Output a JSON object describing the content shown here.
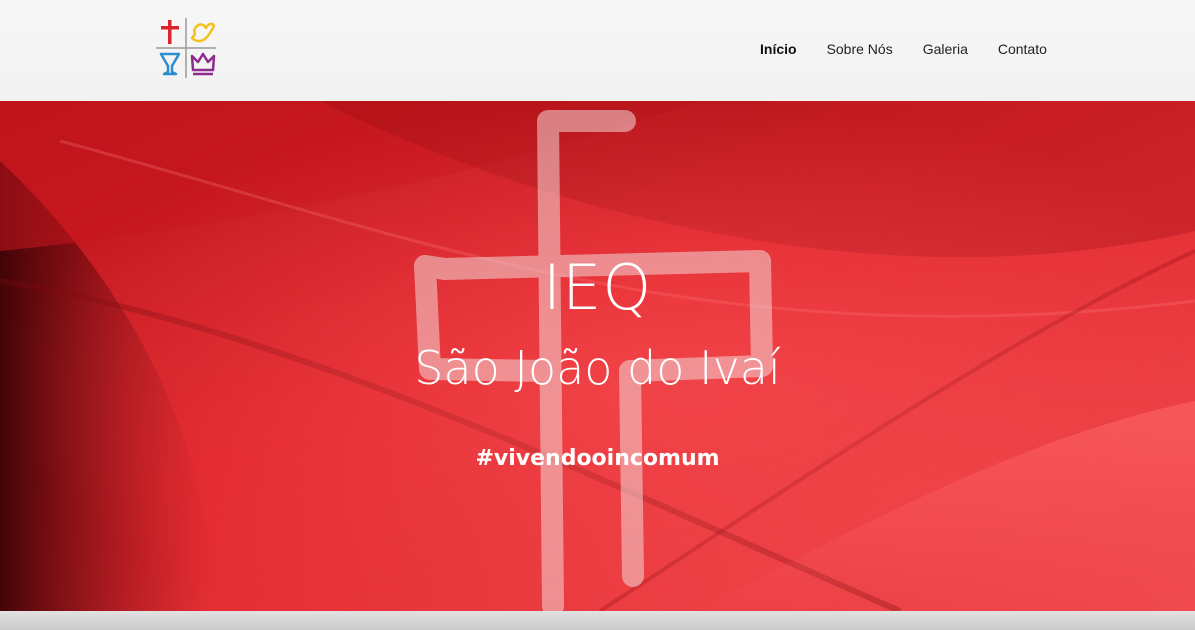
{
  "brand": {
    "logo_name": "ieq-quadrangular-logo",
    "colors": {
      "cross": "#d9252b",
      "dove": "#f2c21a",
      "cup": "#2a8fd0",
      "crown": "#8e2b8f",
      "divider": "#9a9a9a"
    }
  },
  "nav": {
    "items": [
      {
        "label": "Início",
        "active": true
      },
      {
        "label": "Sobre Nós",
        "active": false
      },
      {
        "label": "Galeria",
        "active": false
      },
      {
        "label": "Contato",
        "active": false
      }
    ]
  },
  "hero": {
    "title": "IEQ",
    "subtitle": "São João do Ivaí",
    "hashtag": "#vivendooincomum",
    "background_color": "#d41c22"
  }
}
